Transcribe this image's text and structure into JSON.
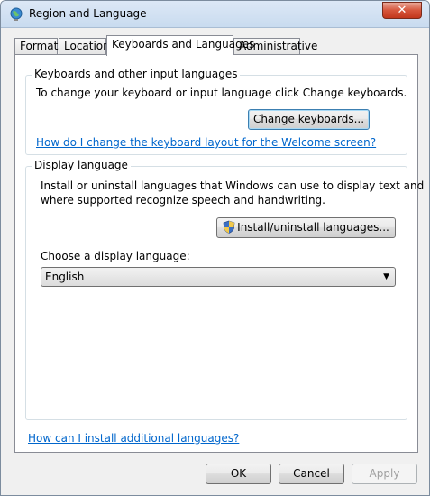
{
  "window": {
    "title": "Region and Language",
    "close_label": "✕"
  },
  "tabs": [
    {
      "label": "Formats"
    },
    {
      "label": "Location"
    },
    {
      "label": "Keyboards and Languages"
    },
    {
      "label": "Administrative"
    }
  ],
  "active_tab": "Keyboards and Languages",
  "keyboards": {
    "group_title": "Keyboards and other input languages",
    "description": "To change your keyboard or input language click Change keyboards.",
    "change_button": "Change keyboards...",
    "help_link": "How do I change the keyboard layout for the Welcome screen?"
  },
  "display_language": {
    "group_title": "Display language",
    "description_line1": "Install or uninstall languages that Windows can use to display text and",
    "description_line2": "where supported recognize speech and handwriting.",
    "install_button": "Install/uninstall languages...",
    "choose_label": "Choose a display language:",
    "selected_language": "English"
  },
  "footer": {
    "help_link": "How can I install additional languages?",
    "ok": "OK",
    "cancel": "Cancel",
    "apply": "Apply"
  },
  "colors": {
    "link": "#0066cc",
    "close_button": "#c7432a"
  }
}
